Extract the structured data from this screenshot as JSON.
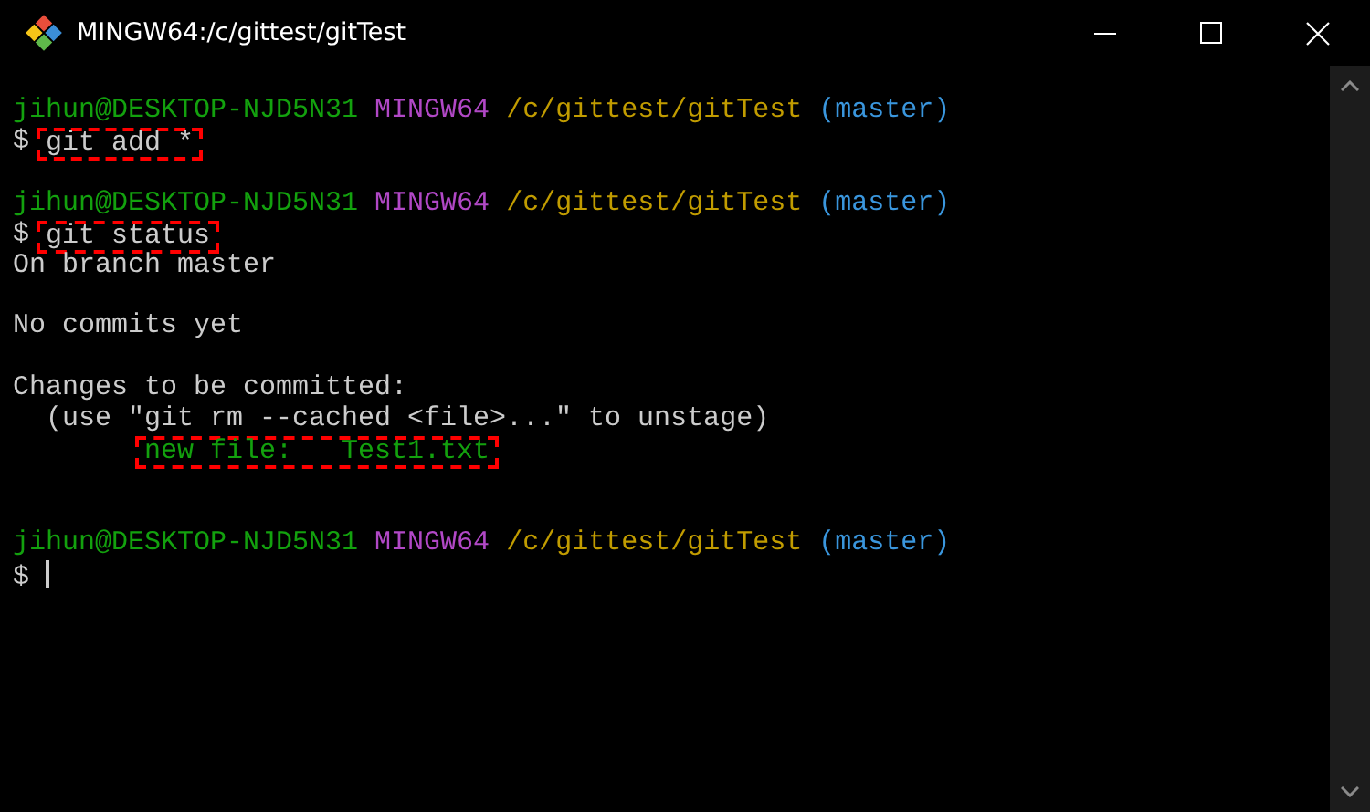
{
  "window": {
    "title": "MINGW64:/c/gittest/gitTest"
  },
  "lines": [
    {
      "kind": "text",
      "segments": [
        {
          "text": "jihun@DESKTOP-NJD5N31 ",
          "color": "#13a10e",
          "highlighted": false
        },
        {
          "text": "MINGW64 ",
          "color": "#b148c6",
          "highlighted": false
        },
        {
          "text": "/c/gittest/gitTest ",
          "color": "#c19c00",
          "highlighted": false
        },
        {
          "text": "(master)",
          "color": "#3a96dd",
          "highlighted": false
        }
      ]
    },
    {
      "kind": "text",
      "segments": [
        {
          "text": "$ ",
          "color": "#cccccc",
          "highlighted": false
        },
        {
          "text": "git add *",
          "color": "#cccccc",
          "highlighted": true
        }
      ]
    },
    {
      "kind": "blank"
    },
    {
      "kind": "text",
      "segments": [
        {
          "text": "jihun@DESKTOP-NJD5N31 ",
          "color": "#13a10e",
          "highlighted": false
        },
        {
          "text": "MINGW64 ",
          "color": "#b148c6",
          "highlighted": false
        },
        {
          "text": "/c/gittest/gitTest ",
          "color": "#c19c00",
          "highlighted": false
        },
        {
          "text": "(master)",
          "color": "#3a96dd",
          "highlighted": false
        }
      ]
    },
    {
      "kind": "text",
      "segments": [
        {
          "text": "$ ",
          "color": "#cccccc",
          "highlighted": false
        },
        {
          "text": "git status",
          "color": "#cccccc",
          "highlighted": true
        }
      ]
    },
    {
      "kind": "text",
      "segments": [
        {
          "text": "On branch master",
          "color": "#cccccc",
          "highlighted": false
        }
      ]
    },
    {
      "kind": "blank"
    },
    {
      "kind": "text",
      "segments": [
        {
          "text": "No commits yet",
          "color": "#cccccc",
          "highlighted": false
        }
      ]
    },
    {
      "kind": "blank"
    },
    {
      "kind": "text",
      "segments": [
        {
          "text": "Changes to be committed:",
          "color": "#cccccc",
          "highlighted": false
        }
      ]
    },
    {
      "kind": "text",
      "segments": [
        {
          "text": "  (use \"git rm --cached <file>...\" to unstage)",
          "color": "#cccccc",
          "highlighted": false
        }
      ]
    },
    {
      "kind": "indented",
      "segments": [
        {
          "text": "new file:   Test1.txt",
          "color": "#13a10e",
          "highlighted": true
        }
      ]
    },
    {
      "kind": "blank"
    },
    {
      "kind": "blank"
    },
    {
      "kind": "text",
      "segments": [
        {
          "text": "jihun@DESKTOP-NJD5N31 ",
          "color": "#13a10e",
          "highlighted": false
        },
        {
          "text": "MINGW64 ",
          "color": "#b148c6",
          "highlighted": false
        },
        {
          "text": "/c/gittest/gitTest ",
          "color": "#c19c00",
          "highlighted": false
        },
        {
          "text": "(master)",
          "color": "#3a96dd",
          "highlighted": false
        }
      ]
    },
    {
      "kind": "cursor",
      "segments": [
        {
          "text": "$ ",
          "color": "#cccccc",
          "highlighted": false
        }
      ]
    }
  ]
}
